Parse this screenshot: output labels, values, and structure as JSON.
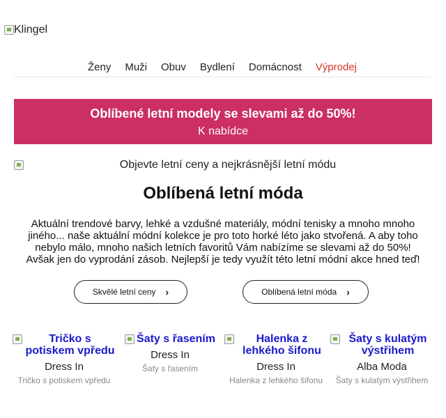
{
  "logo": {
    "alt": "Klingel"
  },
  "nav": [
    {
      "label": "Ženy"
    },
    {
      "label": "Muži"
    },
    {
      "label": "Obuv"
    },
    {
      "label": "Bydlení"
    },
    {
      "label": "Domácnost"
    },
    {
      "label": "Výprodej"
    }
  ],
  "colors": {
    "banner": "#cc2f62",
    "sale": "#d8352b",
    "product_link": "#1a1acc"
  },
  "banner": {
    "title": "Oblíbené letní modely se slevami až do 50%!",
    "link": "K nabídce"
  },
  "hero": {
    "alt": "Objevte letní ceny a nejkrásnější letní módu"
  },
  "headline": "Oblíbená letní móda",
  "intro": "Aktuální trendové barvy, lehké a vzdušné materiály, módní tenisky a mnoho mnoho jiného... naše aktuální módní kolekce je pro toto horké léto jako stvořená. A aby toho nebylo málo, mnoho našich letních favoritů Vám nabízíme se slevami až do 50%! Avšak jen do vyprodání zásob. Nejlepší je tedy využít této letní módní akce hned teď!",
  "buttons": [
    {
      "label": "Skvělé letní ceny",
      "icon": "chevron-right-icon"
    },
    {
      "label": "Oblíbená letní móda",
      "icon": "chevron-right-icon"
    }
  ],
  "products": [
    {
      "image_alt": "Tričko s potiskem vpředu",
      "brand": "Dress In",
      "name": "Tričko s potiskem vpředu"
    },
    {
      "image_alt": "Šaty s řasením",
      "brand": "Dress In",
      "name": "Šaty s řasením"
    },
    {
      "image_alt": "Halenka z lehkého šifonu",
      "brand": "Dress In",
      "name": "Halenka z lehkého šifonu"
    },
    {
      "image_alt": "Šaty s kulatým výstřihem",
      "brand": "Alba Moda",
      "name": "Šaty s kulatým výstřihem"
    }
  ]
}
